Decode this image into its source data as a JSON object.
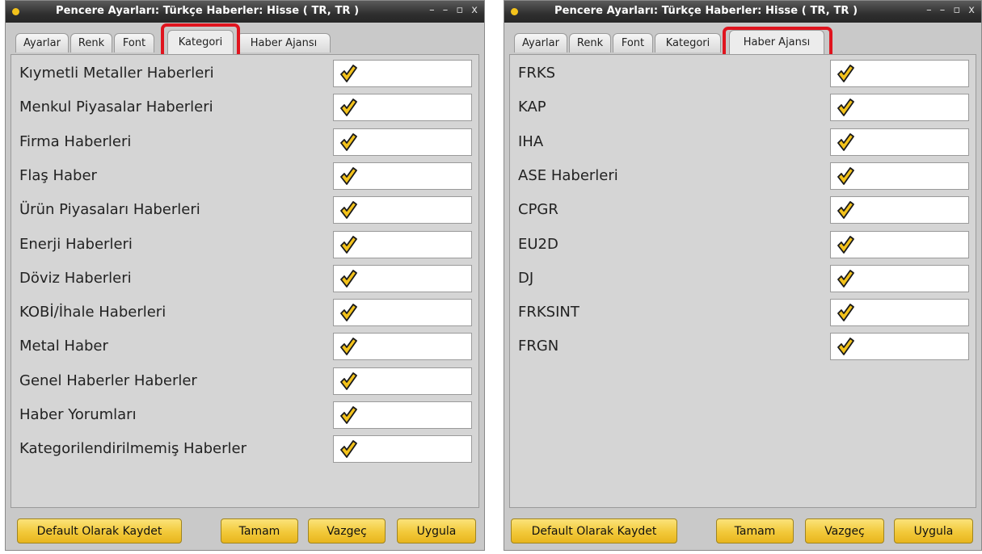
{
  "left_window": {
    "title": "Pencere Ayarları: Türkçe Haberler: Hisse ( TR, TR )",
    "controls": [
      "–",
      "–",
      "▫",
      "x"
    ],
    "tabs": [
      "Ayarlar",
      "Renk",
      "Font",
      "Kategori",
      "Haber Ajansı"
    ],
    "active_tab": "Kategori",
    "rows": [
      {
        "label": "Kıymetli Metaller Haberleri",
        "checked": true
      },
      {
        "label": "Menkul Piyasalar Haberleri",
        "checked": true
      },
      {
        "label": "Firma Haberleri",
        "checked": true
      },
      {
        "label": "Flaş Haber",
        "checked": true
      },
      {
        "label": "Ürün Piyasaları Haberleri",
        "checked": true
      },
      {
        "label": "Enerji Haberleri",
        "checked": true
      },
      {
        "label": "Döviz Haberleri",
        "checked": true
      },
      {
        "label": "KOBİ/İhale Haberleri",
        "checked": true
      },
      {
        "label": "Metal Haber",
        "checked": true
      },
      {
        "label": "Genel Haberler Haberler",
        "checked": true
      },
      {
        "label": "Haber Yorumları",
        "checked": true
      },
      {
        "label": "Kategorilendirilmemiş Haberler",
        "checked": true
      }
    ],
    "buttons": [
      "Default Olarak Kaydet",
      "Tamam",
      "Vazgeç",
      "Uygula"
    ]
  },
  "right_window": {
    "title": "Pencere Ayarları: Türkçe Haberler: Hisse ( TR, TR )",
    "controls": [
      "–",
      "–",
      "▫",
      "x"
    ],
    "tabs": [
      "Ayarlar",
      "Renk",
      "Font",
      "Kategori",
      "Haber Ajansı"
    ],
    "active_tab": "Haber Ajansı",
    "rows": [
      {
        "label": "FRKS",
        "checked": true
      },
      {
        "label": "KAP",
        "checked": true
      },
      {
        "label": "IHA",
        "checked": true
      },
      {
        "label": "ASE Haberleri",
        "checked": true
      },
      {
        "label": "CPGR",
        "checked": true
      },
      {
        "label": "EU2D",
        "checked": true
      },
      {
        "label": "DJ",
        "checked": true
      },
      {
        "label": "FRKSINT",
        "checked": true
      },
      {
        "label": "FRGN",
        "checked": true
      }
    ],
    "buttons": [
      "Default Olarak Kaydet",
      "Tamam",
      "Vazgeç",
      "Uygula"
    ]
  },
  "colors": {
    "highlight": "#e0141e",
    "check": "#f3c21b",
    "button": "#f2c93a",
    "titlebar": "#2f2f2f"
  },
  "icons": {
    "check": "checkmark-icon",
    "window_dot": "window-dot-icon"
  }
}
